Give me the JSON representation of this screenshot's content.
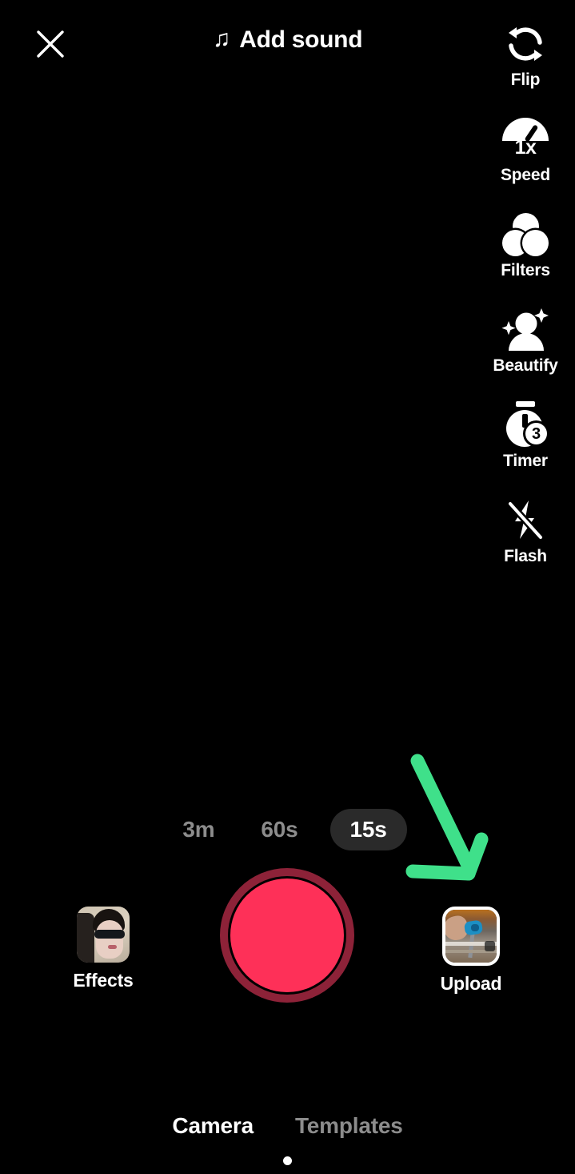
{
  "app": {
    "screen_name": "TikTok Camera",
    "background_color": "#000000"
  },
  "top_bar": {
    "close_icon": "close-x-icon",
    "sound_note_glyph": "♫",
    "add_sound_label": "Add sound"
  },
  "sidebar": {
    "items": [
      {
        "label": "Flip",
        "icon": "flip-camera-icon"
      },
      {
        "label": "Speed",
        "icon": "speedometer-icon",
        "badge": "1x"
      },
      {
        "label": "Filters",
        "icon": "filters-circles-icon"
      },
      {
        "label": "Beautify",
        "icon": "beautify-sparkle-person-icon"
      },
      {
        "label": "Timer",
        "icon": "stopwatch-icon",
        "badge": "3"
      },
      {
        "label": "Flash",
        "icon": "flash-off-icon"
      }
    ]
  },
  "duration": {
    "options": [
      {
        "label": "3m",
        "selected": false
      },
      {
        "label": "60s",
        "selected": false
      },
      {
        "label": "15s",
        "selected": true
      }
    ]
  },
  "record": {
    "name": "record-button",
    "inner_color": "#fe3058",
    "ring_color": "#8d2238"
  },
  "effects": {
    "label": "Effects",
    "thumbnail": "effect-preview-thumbnail"
  },
  "upload": {
    "label": "Upload",
    "thumbnail": "gallery-preview-thumbnail"
  },
  "annotation": {
    "arrow_color": "#3fe08a",
    "points_to": "Upload"
  },
  "bottom_tabs": {
    "tabs": [
      {
        "label": "Camera",
        "active": true
      },
      {
        "label": "Templates",
        "active": false
      }
    ]
  }
}
